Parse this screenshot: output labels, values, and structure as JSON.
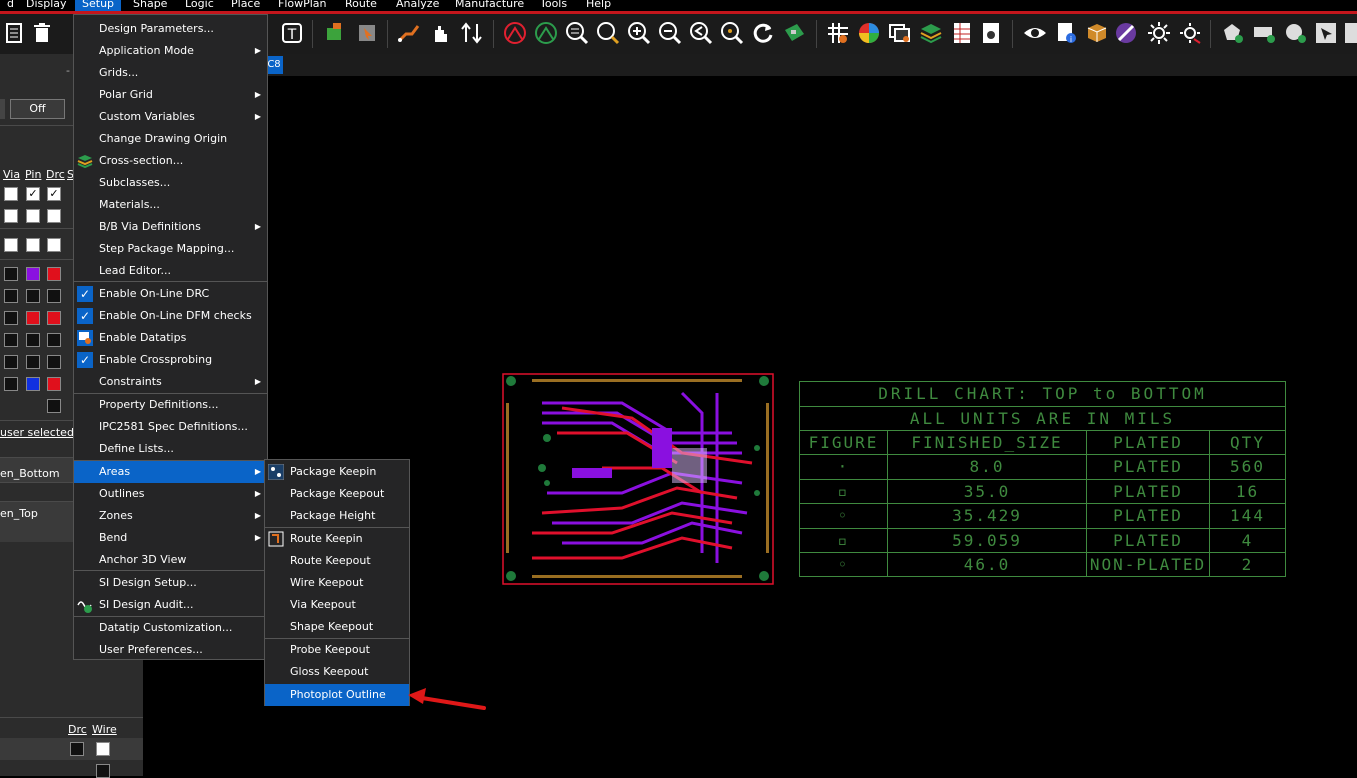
{
  "menubar": {
    "items": [
      "d",
      "Display",
      "Setup",
      "Shape",
      "Logic",
      "Place",
      "FlowPlan",
      "Route",
      "Analyze",
      "Manufacture",
      "Tools",
      "Help"
    ],
    "active": "Setup"
  },
  "left_panel": {
    "off_button": "Off",
    "col_via": "Via",
    "col_pin": "Pin",
    "col_drc": "Drc",
    "col_s": "S",
    "user_selected": "user selected)",
    "row_bottom": "en_Bottom",
    "row_top": "en_Top",
    "bottom_col_drc": "Drc",
    "bottom_col_wire": "Wire"
  },
  "tab": {
    "label": "C8"
  },
  "setup_menu": {
    "items": [
      {
        "label": "Design Parameters...",
        "submenu": false
      },
      {
        "label": "Application Mode",
        "submenu": true
      },
      {
        "label": "Grids...",
        "submenu": false
      },
      {
        "label": "Polar Grid",
        "submenu": true
      },
      {
        "label": "Custom Variables",
        "submenu": true
      },
      {
        "label": "Change Drawing Origin",
        "submenu": false
      },
      {
        "label": "Cross-section...",
        "submenu": false
      },
      {
        "label": "Subclasses...",
        "submenu": false
      },
      {
        "label": "Materials...",
        "submenu": false
      },
      {
        "label": "B/B Via Definitions",
        "submenu": true
      },
      {
        "label": "Step Package Mapping...",
        "submenu": false
      },
      {
        "label": "Lead Editor...",
        "submenu": false
      },
      {
        "label": "Enable On-Line DRC",
        "submenu": false
      },
      {
        "label": "Enable On-Line DFM checks",
        "submenu": false
      },
      {
        "label": "Enable Datatips",
        "submenu": false
      },
      {
        "label": "Enable Crossprobing",
        "submenu": false
      },
      {
        "label": "Constraints",
        "submenu": true
      },
      {
        "label": "Property Definitions...",
        "submenu": false
      },
      {
        "label": "IPC2581 Spec Definitions...",
        "submenu": false
      },
      {
        "label": "Define Lists...",
        "submenu": false
      },
      {
        "label": "Areas",
        "submenu": true
      },
      {
        "label": "Outlines",
        "submenu": true
      },
      {
        "label": "Zones",
        "submenu": true
      },
      {
        "label": "Bend",
        "submenu": true
      },
      {
        "label": "Anchor 3D View",
        "submenu": false
      },
      {
        "label": "SI Design Setup...",
        "submenu": false
      },
      {
        "label": "SI Design Audit...",
        "submenu": false
      },
      {
        "label": "Datatip Customization...",
        "submenu": false
      },
      {
        "label": "User Preferences...",
        "submenu": false
      }
    ]
  },
  "areas_menu": {
    "items": [
      {
        "label": "Package Keepin"
      },
      {
        "label": "Package Keepout"
      },
      {
        "label": "Package Height"
      },
      {
        "label": "Route Keepin"
      },
      {
        "label": "Route Keepout"
      },
      {
        "label": "Wire Keepout"
      },
      {
        "label": "Via Keepout"
      },
      {
        "label": "Shape Keepout"
      },
      {
        "label": "Probe Keepout"
      },
      {
        "label": "Gloss Keepout"
      },
      {
        "label": "Photoplot Outline"
      }
    ]
  },
  "drill_chart": {
    "title": "DRILL CHART: TOP to BOTTOM",
    "subtitle": "ALL UNITS ARE IN MILS",
    "headers": [
      "FIGURE",
      "FINISHED_SIZE",
      "PLATED",
      "QTY"
    ],
    "rows": [
      {
        "figure": "·",
        "size": "8.0",
        "plated": "PLATED",
        "qty": "560"
      },
      {
        "figure": "▫",
        "size": "35.0",
        "plated": "PLATED",
        "qty": "16"
      },
      {
        "figure": "◦",
        "size": "35.429",
        "plated": "PLATED",
        "qty": "144"
      },
      {
        "figure": "▫",
        "size": "59.059",
        "plated": "PLATED",
        "qty": "4"
      },
      {
        "figure": "◦",
        "size": "46.0",
        "plated": "NON-PLATED",
        "qty": "2"
      }
    ]
  },
  "colors": {
    "accent": "#0a64c8",
    "menubar_border": "#c4161c",
    "drill_green": "#3f8a3f",
    "board_red": "#e0102c",
    "board_purple": "#a020f0",
    "annotation_arrow": "#e01818"
  }
}
